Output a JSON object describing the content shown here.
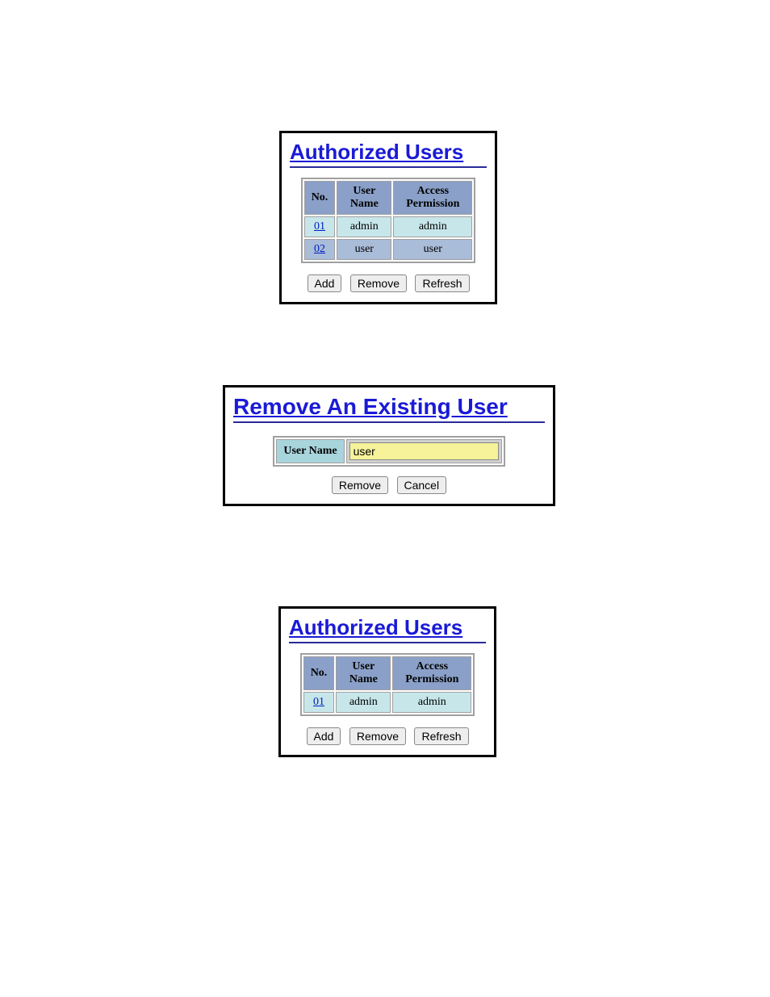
{
  "panel1": {
    "title": "Authorized Users",
    "headers": [
      "No.",
      "User Name",
      "Access Permission"
    ],
    "rows": [
      {
        "no": "01",
        "name": "admin",
        "perm": "admin"
      },
      {
        "no": "02",
        "name": "user",
        "perm": "user"
      }
    ],
    "buttons": {
      "add": "Add",
      "remove": "Remove",
      "refresh": "Refresh"
    }
  },
  "panel2": {
    "title": "Remove An Existing User",
    "label": "User Name",
    "value": "user",
    "buttons": {
      "remove": "Remove",
      "cancel": "Cancel"
    }
  },
  "panel3": {
    "title": "Authorized Users",
    "headers": [
      "No.",
      "User Name",
      "Access Permission"
    ],
    "rows": [
      {
        "no": "01",
        "name": "admin",
        "perm": "admin"
      }
    ],
    "buttons": {
      "add": "Add",
      "remove": "Remove",
      "refresh": "Refresh"
    }
  }
}
